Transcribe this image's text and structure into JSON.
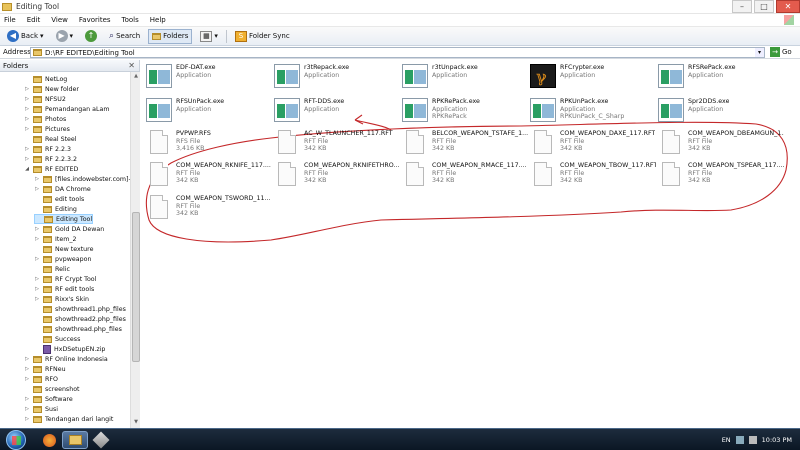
{
  "window": {
    "title": "Editing Tool"
  },
  "window_controls": {
    "minimize": "–",
    "maximize": "□",
    "close": "✕"
  },
  "menu": [
    "File",
    "Edit",
    "View",
    "Favorites",
    "Tools",
    "Help"
  ],
  "toolbar": {
    "back": "Back",
    "search": "Search",
    "folders": "Folders",
    "folder_sync": "Folder Sync"
  },
  "address": {
    "label": "Address",
    "path": "D:\\RF EDITED\\Editing Tool",
    "go": "Go"
  },
  "folders_pane": {
    "title": "Folders",
    "close": "✕"
  },
  "tree": [
    {
      "label": "NetLog",
      "exp": ""
    },
    {
      "label": "New folder",
      "exp": "▷"
    },
    {
      "label": "NFSU2",
      "exp": "▷"
    },
    {
      "label": "Pemandangan aLam",
      "exp": "▷"
    },
    {
      "label": "Photos",
      "exp": "▷"
    },
    {
      "label": "Pictures",
      "exp": "▷"
    },
    {
      "label": "Real Steel",
      "exp": ""
    },
    {
      "label": "RF 2.2.3",
      "exp": "▷"
    },
    {
      "label": "RF 2.2.3.2",
      "exp": "▷"
    },
    {
      "label": "RF EDITED",
      "exp": "◢"
    },
    {
      "label": "[files.indowebster.com]-C",
      "exp": "▷"
    },
    {
      "label": "DA Chrome",
      "exp": "▷"
    },
    {
      "label": "edit tools",
      "exp": ""
    },
    {
      "label": "Editing",
      "exp": ""
    },
    {
      "label": "Editing Tool",
      "exp": ""
    },
    {
      "label": "Gold DA Dewan",
      "exp": "▷"
    },
    {
      "label": "Item_2",
      "exp": "▷"
    },
    {
      "label": "New texture",
      "exp": ""
    },
    {
      "label": "pvpweapon",
      "exp": "▷"
    },
    {
      "label": "Relic",
      "exp": ""
    },
    {
      "label": "RF Crypt Tool",
      "exp": "▷"
    },
    {
      "label": "RF edit tools",
      "exp": "▷"
    },
    {
      "label": "Rixx's Skin",
      "exp": "▷"
    },
    {
      "label": "showthread1.php_files",
      "exp": ""
    },
    {
      "label": "showthread2.php_files",
      "exp": ""
    },
    {
      "label": "showthread.php_files",
      "exp": ""
    },
    {
      "label": "Success",
      "exp": ""
    },
    {
      "label": "HxDSetupEN.zip",
      "exp": "",
      "zip": true
    },
    {
      "label": "RF Online Indonesia",
      "exp": "▷"
    },
    {
      "label": "RFNeu",
      "exp": "▷"
    },
    {
      "label": "RFO",
      "exp": "▷"
    },
    {
      "label": "screenshot",
      "exp": ""
    },
    {
      "label": "Software",
      "exp": "▷"
    },
    {
      "label": "Susi",
      "exp": "▷"
    },
    {
      "label": "Tendangan dari langit",
      "exp": "▷"
    }
  ],
  "files": [
    {
      "name": "EDF-DAT.exe",
      "sub1": "Application",
      "sub2": "",
      "icon": "app"
    },
    {
      "name": "r3tRepack.exe",
      "sub1": "Application",
      "sub2": "",
      "icon": "app"
    },
    {
      "name": "r3tUnpack.exe",
      "sub1": "Application",
      "sub2": "",
      "icon": "app"
    },
    {
      "name": "RFCrypter.exe",
      "sub1": "Application",
      "sub2": "",
      "icon": "rfc"
    },
    {
      "name": "RFSRePack.exe",
      "sub1": "Application",
      "sub2": "",
      "icon": "app"
    },
    {
      "name": "RFSUnPack.exe",
      "sub1": "Application",
      "sub2": "",
      "icon": "app"
    },
    {
      "name": "RFT-DDS.exe",
      "sub1": "Application",
      "sub2": "",
      "icon": "app"
    },
    {
      "name": "RPKRePack.exe",
      "sub1": "Application",
      "sub2": "RPKRePack",
      "icon": "app"
    },
    {
      "name": "RPKUnPack.exe",
      "sub1": "Application",
      "sub2": "RPKUnPack_C_Sharp",
      "icon": "app"
    },
    {
      "name": "Spr2DDS.exe",
      "sub1": "Application",
      "sub2": "",
      "icon": "app"
    },
    {
      "name": "PVPWP.RFS",
      "sub1": "RFS File",
      "sub2": "3,416 KB",
      "icon": "doc"
    },
    {
      "name": "AC_W_TLAUNCHER_117.RFT",
      "sub1": "RFT File",
      "sub2": "342 KB",
      "icon": "doc"
    },
    {
      "name": "BELCOR_WEAPON_TSTAFE_1...",
      "sub1": "RFT File",
      "sub2": "342 KB",
      "icon": "doc"
    },
    {
      "name": "COM_WEAPON_DAXE_117.RFT",
      "sub1": "RFT File",
      "sub2": "342 KB",
      "icon": "doc"
    },
    {
      "name": "COM_WEAPON_DBEAMGUN_1...",
      "sub1": "RFT File",
      "sub2": "342 KB",
      "icon": "doc"
    },
    {
      "name": "COM_WEAPON_RKNIFE_117....",
      "sub1": "RFT File",
      "sub2": "342 KB",
      "icon": "doc"
    },
    {
      "name": "COM_WEAPON_RKNIFETHRO...",
      "sub1": "RFT File",
      "sub2": "342 KB",
      "icon": "doc"
    },
    {
      "name": "COM_WEAPON_RMACE_117....",
      "sub1": "RFT File",
      "sub2": "342 KB",
      "icon": "doc"
    },
    {
      "name": "COM_WEAPON_TBOW_117.RFT",
      "sub1": "RFT File",
      "sub2": "342 KB",
      "icon": "doc"
    },
    {
      "name": "COM_WEAPON_TSPEAR_117....",
      "sub1": "RFT File",
      "sub2": "342 KB",
      "icon": "doc"
    },
    {
      "name": "COM_WEAPON_TSWORD_11...",
      "sub1": "RFT File",
      "sub2": "342 KB",
      "icon": "doc"
    }
  ],
  "taskbar": {
    "lang": "EN",
    "clock": "10:03 PM"
  },
  "colors": {
    "annotation": "#c4282a",
    "selection": "#cce8ff",
    "taskbar": "#0f1e2e"
  }
}
